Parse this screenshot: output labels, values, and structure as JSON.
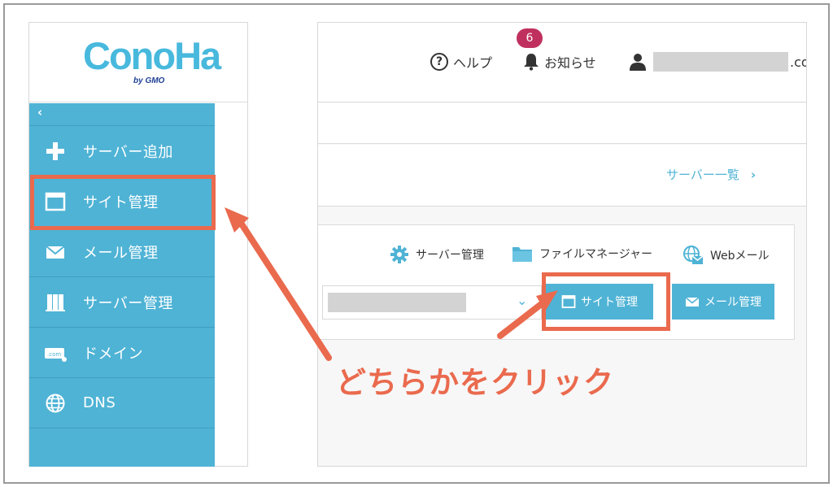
{
  "logo": {
    "main": "ConoHa",
    "sub": "by GMO"
  },
  "sidebar": {
    "collapse": "‹",
    "items": [
      {
        "label": "サーバー追加",
        "icon": "plus-icon"
      },
      {
        "label": "サイト管理",
        "icon": "window-icon"
      },
      {
        "label": "メール管理",
        "icon": "envelope-icon"
      },
      {
        "label": "サーバー管理",
        "icon": "server-icon"
      },
      {
        "label": "ドメイン",
        "icon": "domain-icon"
      },
      {
        "label": "DNS",
        "icon": "globe-icon"
      }
    ]
  },
  "topbar": {
    "help": "ヘルプ",
    "notice": "お知らせ",
    "notice_count": "6",
    "user_suffix": ".co"
  },
  "server_list_link": "サーバー一覧",
  "card": {
    "tools": {
      "server_manage": "サーバー管理",
      "file_manager": "ファイルマネージャー",
      "webmail": "Webメール"
    },
    "buttons": {
      "site_manage": "サイト管理",
      "mail_manage": "メール管理"
    }
  },
  "callout": "どちらかをクリック",
  "colors": {
    "accent": "#4fb3d5",
    "highlight": "#ea6a4e",
    "badge": "#c0305f"
  }
}
